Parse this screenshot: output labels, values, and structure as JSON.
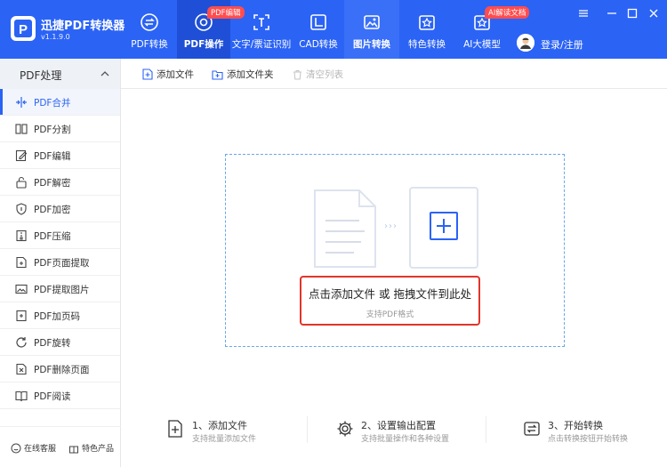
{
  "app": {
    "name": "迅捷PDF转换器",
    "version": "v1.1.9.0",
    "logo_letter": "P"
  },
  "nav": [
    {
      "label": "PDF转换",
      "icon": "convert-icon",
      "badge": ""
    },
    {
      "label": "PDF操作",
      "icon": "pdf-ops-icon",
      "badge": "PDF编辑"
    },
    {
      "label": "文字/票证识别",
      "icon": "ocr-icon",
      "badge": ""
    },
    {
      "label": "CAD转换",
      "icon": "cad-icon",
      "badge": ""
    },
    {
      "label": "图片转换",
      "icon": "image-icon",
      "badge": ""
    },
    {
      "label": "特色转换",
      "icon": "special-icon",
      "badge": ""
    },
    {
      "label": "AI大模型",
      "icon": "ai-icon",
      "badge": "AI解读文档"
    }
  ],
  "user": {
    "login_label": "登录/注册"
  },
  "sidebar": {
    "header": "PDF处理",
    "items": [
      {
        "label": "PDF合并",
        "icon": "merge-icon"
      },
      {
        "label": "PDF分割",
        "icon": "split-icon"
      },
      {
        "label": "PDF编辑",
        "icon": "edit-icon"
      },
      {
        "label": "PDF解密",
        "icon": "unlock-icon"
      },
      {
        "label": "PDF加密",
        "icon": "shield-icon"
      },
      {
        "label": "PDF压缩",
        "icon": "compress-icon"
      },
      {
        "label": "PDF页面提取",
        "icon": "page-extract-icon"
      },
      {
        "label": "PDF提取图片",
        "icon": "image-extract-icon"
      },
      {
        "label": "PDF加页码",
        "icon": "page-number-icon"
      },
      {
        "label": "PDF旋转",
        "icon": "rotate-icon"
      },
      {
        "label": "PDF删除页面",
        "icon": "delete-page-icon"
      },
      {
        "label": "PDF阅读",
        "icon": "read-icon"
      }
    ],
    "footer": {
      "service": "在线客服",
      "featured": "特色产品"
    }
  },
  "toolbar": {
    "add_file": "添加文件",
    "add_folder": "添加文件夹",
    "clear_list": "清空列表"
  },
  "dropzone": {
    "main_hint": "点击添加文件 或 拖拽文件到此处",
    "sub_hint": "支持PDF格式"
  },
  "steps": [
    {
      "title": "1、添加文件",
      "desc": "支持批量添加文件"
    },
    {
      "title": "2、设置输出配置",
      "desc": "支持批量操作和各种设置"
    },
    {
      "title": "3、开始转换",
      "desc": "点击转换按钮开始转换"
    }
  ],
  "colors": {
    "brand": "#2b63f5",
    "highlight": "#e0352b",
    "badge": "#ff4d4f"
  }
}
